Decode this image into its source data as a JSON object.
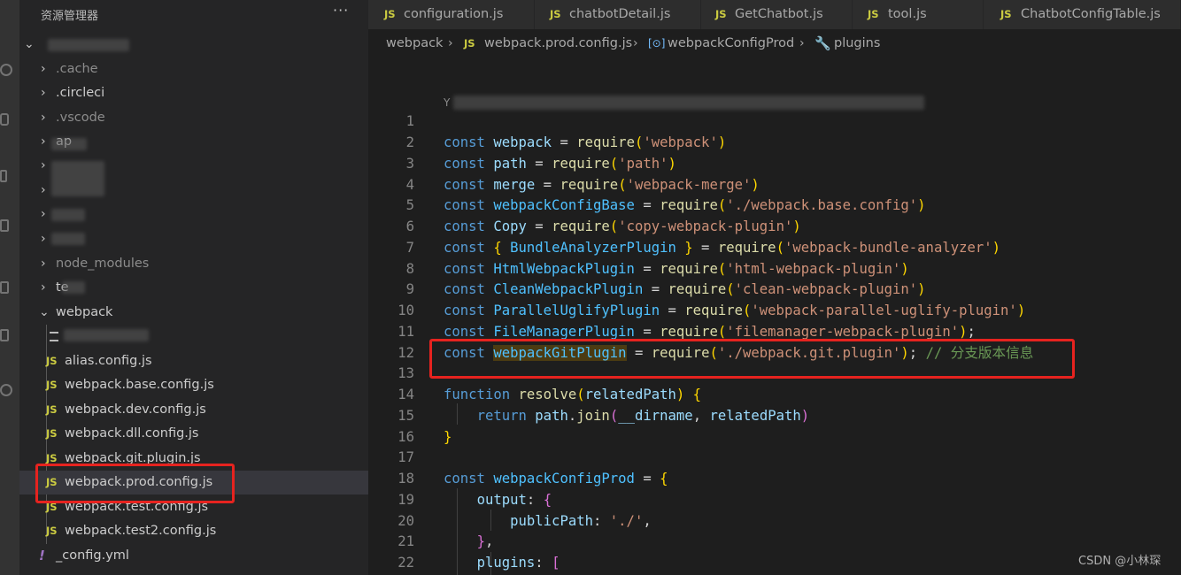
{
  "explorer": {
    "title": "资源管理器",
    "more": "···",
    "tree": [
      {
        "label": "",
        "expanded": true
      },
      {
        "label": ".cache"
      },
      {
        "label": ".circleci"
      },
      {
        "label": ".vscode"
      },
      {
        "label": "ap"
      },
      {
        "label": ""
      },
      {
        "label": ""
      },
      {
        "label": ""
      },
      {
        "label": ""
      },
      {
        "label": "node_modules"
      },
      {
        "label": "te"
      },
      {
        "label": "webpack",
        "expanded": true
      },
      {
        "label": ""
      },
      {
        "label": "alias.config.js"
      },
      {
        "label": "webpack.base.config.js"
      },
      {
        "label": "webpack.dev.config.js"
      },
      {
        "label": "webpack.dll.config.js"
      },
      {
        "label": "webpack.git.plugin.js"
      },
      {
        "label": "webpack.prod.config.js",
        "selected": true
      },
      {
        "label": "webpack.test.config.js"
      },
      {
        "label": "webpack.test2.config.js"
      },
      {
        "label": "_config.yml"
      }
    ]
  },
  "tabs": [
    {
      "label": "configuration.js"
    },
    {
      "label": "chatbotDetail.js"
    },
    {
      "label": "GetChatbot.js"
    },
    {
      "label": "tool.js"
    },
    {
      "label": "ChatbotConfigTable.js"
    }
  ],
  "badge_js": "JS",
  "badge_yml": "!",
  "breadcrumb": {
    "folder": "webpack",
    "file": "webpack.prod.config.js",
    "symbol1": "webpackConfigProd",
    "symbol2": "plugins",
    "sep": "›"
  },
  "editor": {
    "codelens": "Y",
    "lines": [
      {
        "n": "1"
      },
      {
        "n": "2"
      },
      {
        "n": "3"
      },
      {
        "n": "4"
      },
      {
        "n": "5"
      },
      {
        "n": "6"
      },
      {
        "n": "7"
      },
      {
        "n": "8"
      },
      {
        "n": "9"
      },
      {
        "n": "10"
      },
      {
        "n": "11"
      },
      {
        "n": "12"
      },
      {
        "n": "13"
      },
      {
        "n": "14"
      },
      {
        "n": "15"
      },
      {
        "n": "16"
      },
      {
        "n": "17"
      },
      {
        "n": "18"
      },
      {
        "n": "19"
      },
      {
        "n": "20"
      },
      {
        "n": "21"
      },
      {
        "n": "22"
      }
    ],
    "t": {
      "const": "const",
      "function": "function",
      "return": "return",
      "require": "require",
      "webpack": "webpack",
      "path": "path",
      "merge": "merge",
      "webpackConfigBase": "webpackConfigBase",
      "Copy": "Copy",
      "BundleAnalyzerPlugin": "BundleAnalyzerPlugin",
      "HtmlWebpackPlugin": "HtmlWebpackPlugin",
      "CleanWebpackPlugin": "CleanWebpackPlugin",
      "ParallelUglifyPlugin": "ParallelUglifyPlugin",
      "FileManagerPlugin": "FileManagerPlugin",
      "webpackGitPlugin": "webpackGitPlugin",
      "s_webpack": "'webpack'",
      "s_path": "'path'",
      "s_merge": "'webpack-merge'",
      "s_base": "'./webpack.base.config'",
      "s_copy": "'copy-webpack-plugin'",
      "s_bundle": "'webpack-bundle-analyzer'",
      "s_html": "'html-webpack-plugin'",
      "s_clean": "'clean-webpack-plugin'",
      "s_parallel": "'webpack-parallel-uglify-plugin'",
      "s_filemanager": "'filemanager-webpack-plugin'",
      "s_git": "'./webpack.git.plugin'",
      "comment": "// 分支版本信息",
      "resolve": "resolve",
      "relatedPath": "relatedPath",
      "join": "join",
      "dirname": "__dirname",
      "webpackConfigProd": "webpackConfigProd",
      "output": "output",
      "publicPath": "publicPath",
      "s_dot": "'./'",
      "plugins": "plugins"
    }
  },
  "watermark": "CSDN @小林琛"
}
